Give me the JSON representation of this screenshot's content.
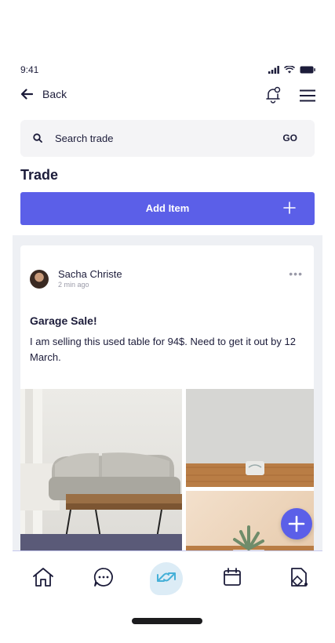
{
  "status_bar": {
    "time": "9:41"
  },
  "header": {
    "back_label": "Back"
  },
  "search": {
    "placeholder": "Search trade",
    "go_label": "GO"
  },
  "page": {
    "title": "Trade"
  },
  "add_item": {
    "label": "Add Item"
  },
  "post": {
    "author": "Sacha Christe",
    "posted": "2 min ago",
    "more": "•••",
    "title": "Garage Sale!",
    "body": "I am selling this used table for 94$. Need to get it out by 12 March."
  },
  "bottom_nav": {
    "items": [
      {
        "icon": "home-icon"
      },
      {
        "icon": "chat-icon"
      },
      {
        "icon": "trade-icon",
        "active": true
      },
      {
        "icon": "calendar-icon"
      },
      {
        "icon": "document-icon"
      }
    ]
  },
  "colors": {
    "accent": "#5b5fe8",
    "text": "#1c1c3a",
    "feed_bg": "#eef0f4",
    "search_bg": "#f4f4f6",
    "active_nav_bg": "#dcecf6"
  }
}
